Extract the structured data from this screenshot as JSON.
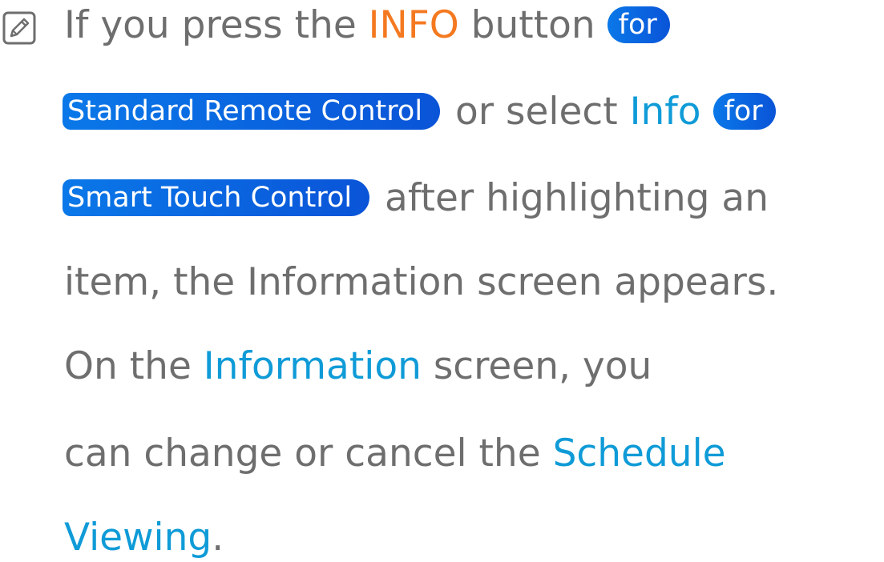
{
  "note": {
    "icon": "note-icon",
    "line1": {
      "t1": "If you press the ",
      "info_button": "INFO",
      "t2": " button ",
      "pill_for_1": "for"
    },
    "line2": {
      "pill_standard_remote": "Standard Remote Control",
      "t1": " or select ",
      "info_link": "Info",
      "t2": " ",
      "pill_for_2": "for"
    },
    "line3": {
      "pill_smart_touch": "Smart Touch Control",
      "t1": " after highlighting an"
    },
    "line4": {
      "t1": "item, the Information screen appears."
    },
    "line5": {
      "t1": "On the ",
      "information_link": "Information",
      "t2": " screen, you"
    },
    "line6": {
      "t1": "can change or cancel the ",
      "schedule_link": "Schedule"
    },
    "line7": {
      "viewing_link": "Viewing",
      "t1": "."
    }
  },
  "colors": {
    "text": "#6e6e6e",
    "orange": "#f47920",
    "blue": "#0f9bd7",
    "pill": "#0a64e0"
  }
}
